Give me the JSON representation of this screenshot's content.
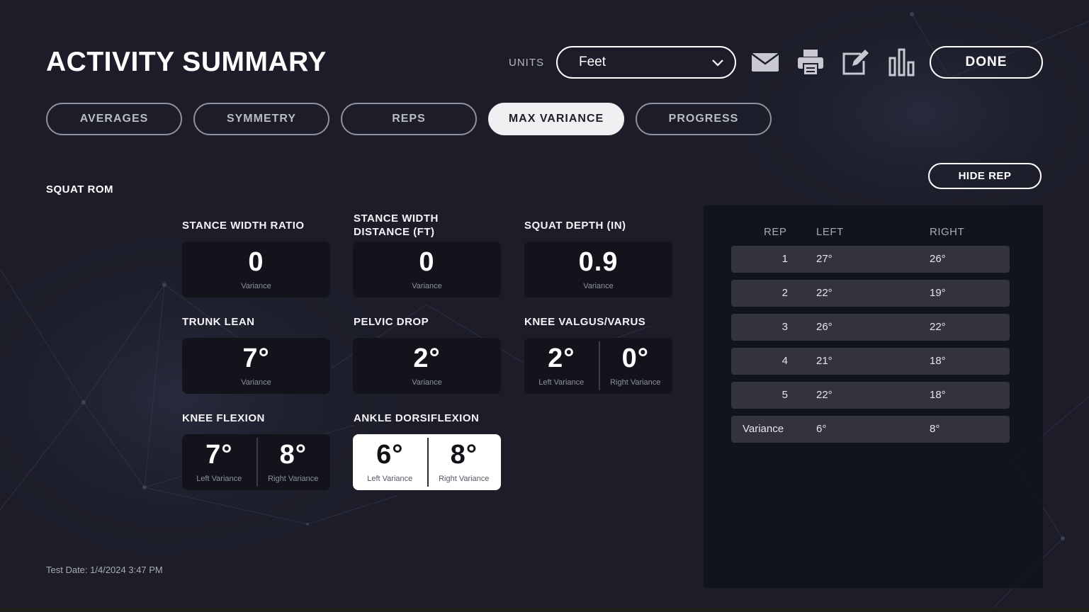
{
  "header": {
    "title": "ACTIVITY SUMMARY",
    "units_label": "UNITS",
    "units_value": "Feet",
    "done_label": "DONE",
    "icons": [
      "mail-icon",
      "print-icon",
      "edit-icon",
      "bar-chart-icon"
    ]
  },
  "tabs": [
    {
      "label": "AVERAGES",
      "active": false
    },
    {
      "label": "SYMMETRY",
      "active": false
    },
    {
      "label": "REPS",
      "active": false
    },
    {
      "label": "MAX VARIANCE",
      "active": true
    },
    {
      "label": "PROGRESS",
      "active": false
    }
  ],
  "section_title": "SQUAT ROM",
  "hide_rep_label": "HIDE REP",
  "metrics": {
    "stance_width_ratio": {
      "label": "STANCE WIDTH RATIO",
      "value": "0",
      "sub": "Variance"
    },
    "stance_width_distance": {
      "label_line1": "STANCE WIDTH",
      "label_line2": "DISTANCE (FT)",
      "value": "0",
      "sub": "Variance"
    },
    "squat_depth": {
      "label": "SQUAT DEPTH (IN)",
      "value": "0.9",
      "sub": "Variance"
    },
    "trunk_lean": {
      "label": "TRUNK LEAN",
      "value": "7°",
      "sub": "Variance"
    },
    "pelvic_drop": {
      "label": "PELVIC DROP",
      "value": "2°",
      "sub": "Variance"
    },
    "knee_valgus_varus": {
      "label": "KNEE VALGUS/VARUS",
      "left_value": "2°",
      "left_sub": "Left Variance",
      "right_value": "0°",
      "right_sub": "Right Variance"
    },
    "knee_flexion": {
      "label": "KNEE FLEXION",
      "left_value": "7°",
      "left_sub": "Left Variance",
      "right_value": "8°",
      "right_sub": "Right Variance"
    },
    "ankle_dorsiflexion": {
      "label": "ANKLE DORSIFLEXION",
      "left_value": "6°",
      "left_sub": "Left Variance",
      "right_value": "8°",
      "right_sub": "Right Variance"
    }
  },
  "rep_table": {
    "headers": {
      "rep": "REP",
      "left": "LEFT",
      "right": "RIGHT"
    },
    "rows": [
      {
        "rep": "1",
        "left": "27°",
        "right": "26°"
      },
      {
        "rep": "2",
        "left": "22°",
        "right": "19°"
      },
      {
        "rep": "3",
        "left": "26°",
        "right": "22°"
      },
      {
        "rep": "4",
        "left": "21°",
        "right": "18°"
      },
      {
        "rep": "5",
        "left": "22°",
        "right": "18°"
      },
      {
        "rep": "Variance",
        "left": "6°",
        "right": "8°"
      }
    ]
  },
  "test_date": "Test Date: 1/4/2024 3:47 PM"
}
